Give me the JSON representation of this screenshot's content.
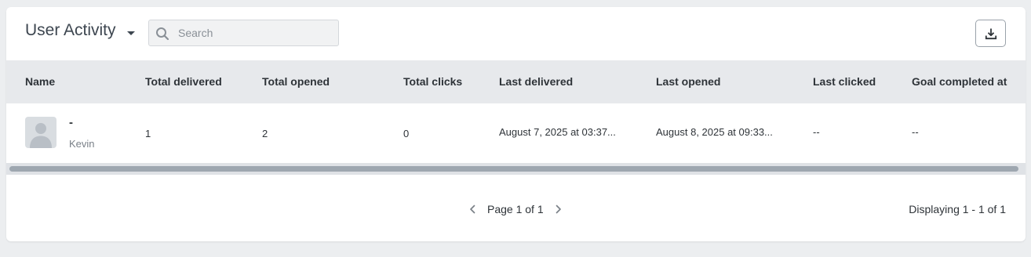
{
  "header": {
    "title": "User Activity",
    "search_placeholder": "Search"
  },
  "table": {
    "columns": [
      "Name",
      "Total delivered",
      "Total opened",
      "Total clicks",
      "Last delivered",
      "Last opened",
      "Last clicked",
      "Goal completed at"
    ],
    "rows": [
      {
        "name": "-",
        "username": "Kevin",
        "total_delivered": "1",
        "total_opened": "2",
        "total_clicks": "0",
        "last_delivered": "August 7, 2025 at 03:37...",
        "last_opened": "August 8, 2025 at 09:33...",
        "last_clicked": "--",
        "goal_completed_at": "--"
      }
    ]
  },
  "pagination": {
    "page_label": "Page 1 of 1",
    "displaying": "Displaying 1 - 1 of 1"
  },
  "icons": {
    "dropdown": "caret-down-icon",
    "search": "search-icon",
    "download": "download-icon",
    "prev": "chevron-left-icon",
    "next": "chevron-right-icon",
    "avatar": "user-avatar-icon"
  }
}
